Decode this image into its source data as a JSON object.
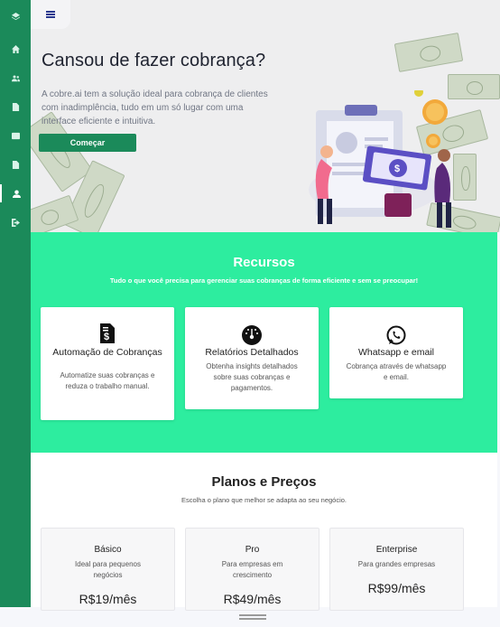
{
  "sidebar": {
    "icons": [
      "layers-icon",
      "home-icon",
      "users-icon",
      "document-icon",
      "mail-icon",
      "report-icon",
      "user-icon",
      "logout-icon"
    ],
    "active": "user-icon",
    "color": "#1b8a5a"
  },
  "hero": {
    "title": "Cansou de fazer cobrança?",
    "text": "A cobre.ai tem a solução ideal para cobrança de clientes com inadimplência, tudo em um só lugar com uma interface eficiente e intuitiva.",
    "button": "Começar"
  },
  "recursos": {
    "title": "Recursos",
    "subtitle": "Tudo o que você precisa para gerenciar suas cobranças de forma eficiente e sem se preocupar!",
    "cards": [
      {
        "icon": "invoice-dollar-icon",
        "title": "Automação de Cobranças",
        "desc": "Automatize suas cobranças e reduza o trabalho manual."
      },
      {
        "icon": "gauge-icon",
        "title": "Relatórios Detalhados",
        "desc": "Obtenha insights detalhados sobre suas cobranças e pagamentos."
      },
      {
        "icon": "whatsapp-icon",
        "title": "Whatsapp e email",
        "desc": "Cobrança através de whatsapp e email."
      }
    ],
    "color": "#2ded9f"
  },
  "planos": {
    "title": "Planos e Preços",
    "subtitle": "Escolha o plano que melhor se adapta ao seu negócio.",
    "plans": [
      {
        "name": "Básico",
        "desc": "Ideal para pequenos negócios",
        "price": "R$19/mês"
      },
      {
        "name": "Pro",
        "desc": "Para empresas em crescimento",
        "price": "R$49/mês"
      },
      {
        "name": "Enterprise",
        "desc": "Para grandes empresas",
        "price": "R$99/mês"
      }
    ]
  }
}
